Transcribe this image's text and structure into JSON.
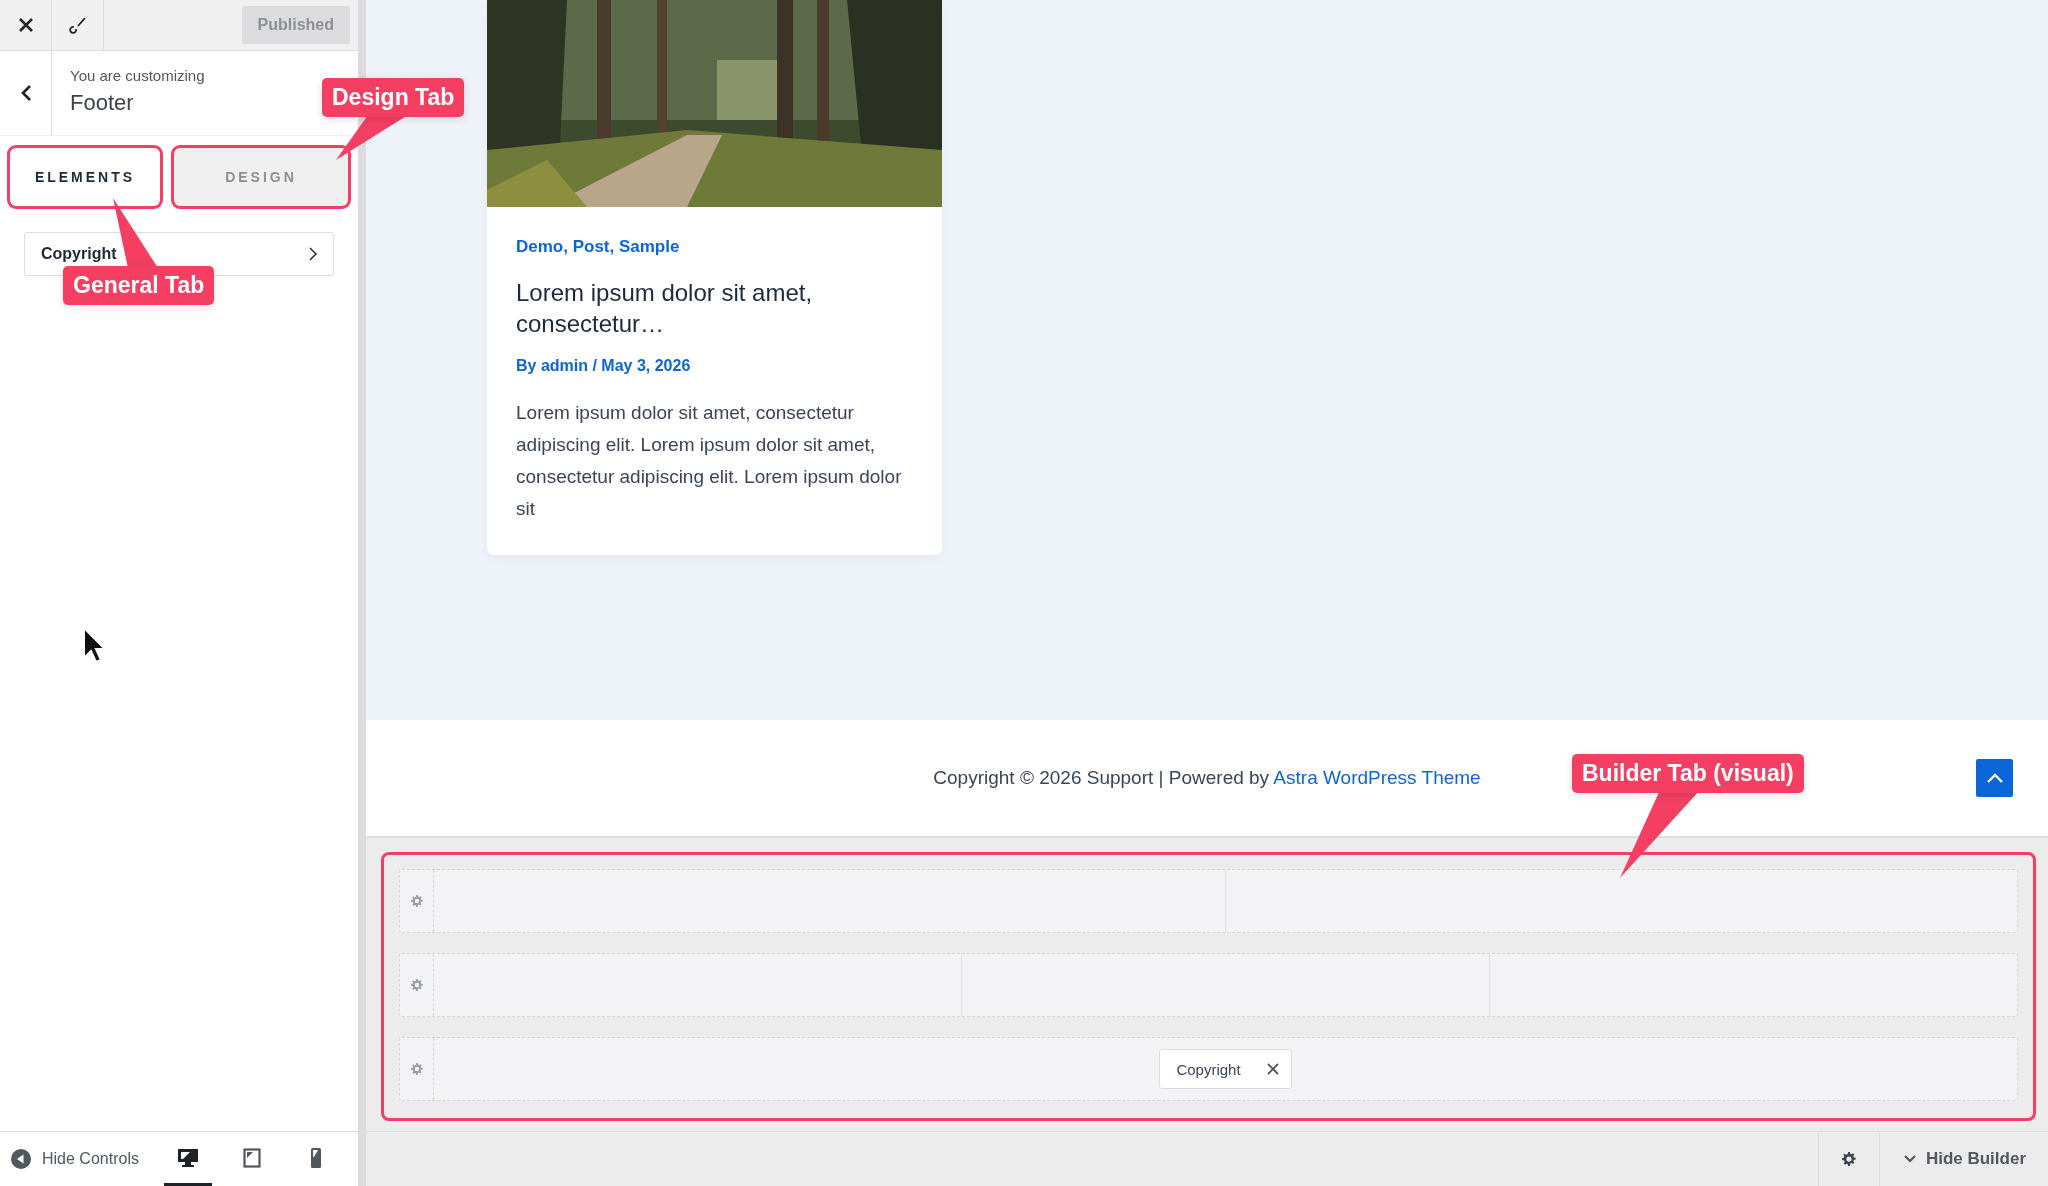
{
  "toolbar": {
    "publish_button": "Published"
  },
  "header": {
    "subtitle": "You are customizing",
    "title": "Footer"
  },
  "tabs": [
    {
      "label": "ELEMENTS",
      "selected": true,
      "highlighted": true,
      "callout": "General Tab"
    },
    {
      "label": "DESIGN",
      "selected": false,
      "highlighted": true,
      "callout": "Design Tab"
    }
  ],
  "sidebar_items": [
    {
      "label": "Copyright"
    }
  ],
  "footer_controls": {
    "hide_controls": "Hide Controls",
    "devices": [
      {
        "kind": "desktop",
        "selected": true
      },
      {
        "kind": "tablet",
        "selected": false
      },
      {
        "kind": "mobile",
        "selected": false
      }
    ]
  },
  "post": {
    "categories": "Demo, Post, Sample",
    "title": "Lorem ipsum dolor sit amet, consectetur…",
    "meta": "By admin / May 3, 2026",
    "excerpt": "Lorem ipsum dolor sit amet, consectetur adipiscing elit. Lorem ipsum dolor sit amet, consectetur adipiscing elit. Lorem ipsum dolor sit"
  },
  "site_footer": {
    "text": "Copyright © 2026 Support | Powered by ",
    "link": "Astra WordPress Theme"
  },
  "builder": {
    "highlighted": true,
    "callout": "Builder Tab (visual)",
    "rows": [
      {
        "cells": [
          {
            "kind": "empty"
          },
          {
            "kind": "empty"
          }
        ]
      },
      {
        "cells": [
          {
            "kind": "empty"
          },
          {
            "kind": "empty"
          },
          {
            "kind": "empty"
          }
        ]
      },
      {
        "cells": [
          {
            "kind": "slot",
            "items": [
              {
                "label": "Copyright"
              }
            ]
          }
        ]
      }
    ]
  },
  "builder_bar": {
    "hide_builder": "Hide Builder"
  }
}
